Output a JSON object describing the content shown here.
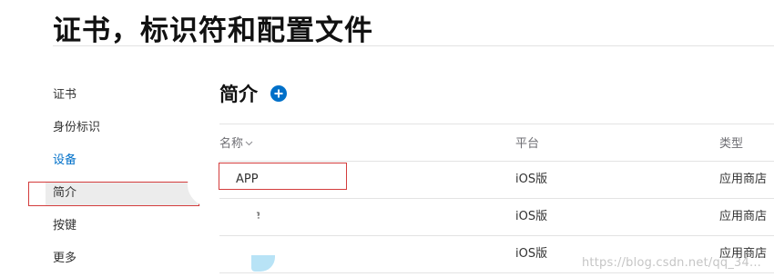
{
  "page_title": "证书，标识符和配置文件",
  "sidebar": {
    "items": [
      {
        "label": "证书"
      },
      {
        "label": "身份标识"
      },
      {
        "label": "设备"
      },
      {
        "label": "简介"
      },
      {
        "label": "按键"
      },
      {
        "label": "更多"
      }
    ]
  },
  "section": {
    "title": "简介",
    "add_icon": "plus-circle-icon"
  },
  "table": {
    "columns": [
      "名称",
      "平台",
      "类型"
    ],
    "sort_icon": "chevron-down-icon",
    "rows": [
      {
        "name": "APP",
        "platform": "iOS版",
        "type": "应用商店"
      },
      {
        "name": "ㄹ",
        "platform": "iOS版",
        "type": "应用商店"
      },
      {
        "name": "",
        "platform": "iOS版",
        "type": "应用商店"
      }
    ]
  },
  "watermark": "https://blog.csdn.net/qq_34...",
  "colors": {
    "accent": "#0070c9",
    "highlight_border": "#d33c3c",
    "selected_bg": "#ececec"
  }
}
